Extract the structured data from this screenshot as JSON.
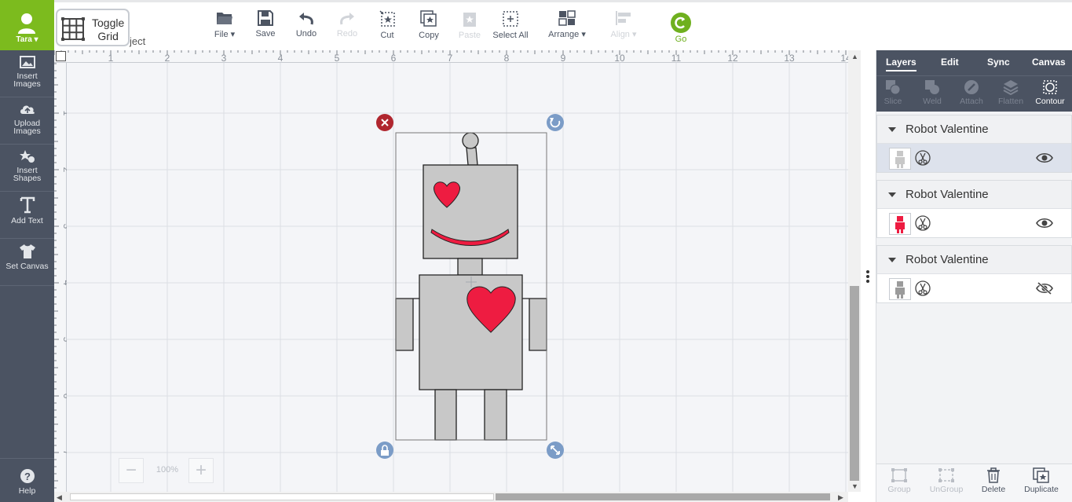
{
  "user": {
    "name": "Tara"
  },
  "sidebar": {
    "items": [
      {
        "label_line1": "Insert",
        "label_line2": "Images",
        "icon": "image-icon"
      },
      {
        "label_line1": "Upload",
        "label_line2": "Images",
        "icon": "upload-cloud-icon"
      },
      {
        "label_line1": "Insert",
        "label_line2": "Shapes",
        "icon": "shapes-icon"
      },
      {
        "label_line1": "Add Text",
        "label_line2": "",
        "icon": "text-icon"
      },
      {
        "label_line1": "Set Canvas",
        "label_line2": "",
        "icon": "tshirt-icon"
      }
    ],
    "help_label": "Help"
  },
  "toolbar": {
    "toggle_grid_line1": "Toggle",
    "toggle_grid_line2": "Grid",
    "ghost_text": "ject",
    "file": "File",
    "save": "Save",
    "undo": "Undo",
    "redo": "Redo",
    "cut": "Cut",
    "copy": "Copy",
    "paste": "Paste",
    "select_all": "Select All",
    "arrange": "Arrange",
    "align": "Align",
    "go": "Go"
  },
  "ruler": {
    "top": [
      "1",
      "2",
      "3",
      "4",
      "5",
      "6",
      "7",
      "8",
      "9",
      "10",
      "11",
      "12",
      "13",
      "14"
    ],
    "left": [
      "1",
      "2",
      "3",
      "4",
      "5",
      "6",
      "7"
    ]
  },
  "zoom": {
    "minus": "−",
    "plus": "+",
    "level": "100%"
  },
  "panel": {
    "tabs": [
      "Layers",
      "Edit",
      "Sync",
      "Canvas"
    ],
    "tools": [
      "Slice",
      "Weld",
      "Attach",
      "Flatten",
      "Contour"
    ],
    "layers": [
      {
        "title": "Robot Valentine",
        "visible": true,
        "color": "#c8c8c8"
      },
      {
        "title": "Robot Valentine",
        "visible": true,
        "color": "#ee1c41"
      },
      {
        "title": "Robot Valentine",
        "visible": false,
        "color": "#9b9b9b"
      }
    ],
    "bottom": [
      "Group",
      "UnGroup",
      "Delete",
      "Duplicate"
    ]
  },
  "colors": {
    "sidebar": "#4b5362",
    "accent_green": "#7cbb1e",
    "heart_red": "#ee1c41",
    "robot_gray": "#c8c8c8",
    "delete_red": "#b0262f",
    "handle_blue": "#7b9cc7"
  }
}
